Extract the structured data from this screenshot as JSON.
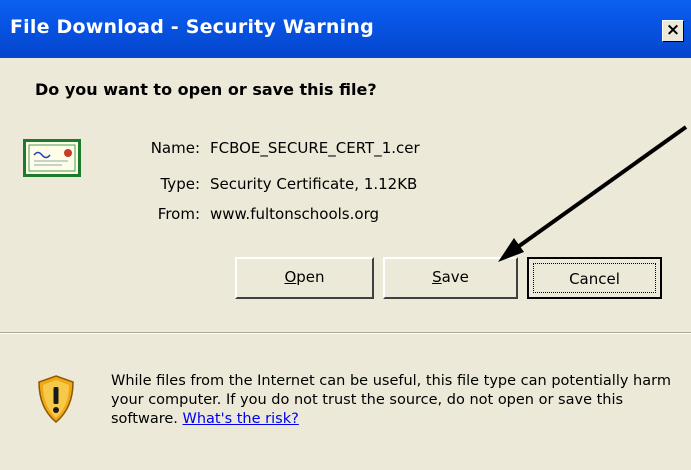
{
  "window": {
    "title": "File Download - Security Warning",
    "close_glyph": "×"
  },
  "prompt": {
    "question": "Do you want to open or save this file?"
  },
  "file": {
    "name_label": "Name:",
    "name_value": "FCBOE_SECURE_CERT_1.cer",
    "type_label": "Type:",
    "type_value": "Security Certificate, 1.12KB",
    "from_label": "From:",
    "from_value": "www.fultonschools.org",
    "icon": "certificate-icon"
  },
  "buttons": {
    "open_mnemonic": "O",
    "open_rest": "pen",
    "save_mnemonic": "S",
    "save_rest": "ave",
    "cancel": "Cancel"
  },
  "warning": {
    "text": "While files from the Internet can be useful, this file type can potentially harm your computer. If you do not trust the source, do not open or save this software. ",
    "link": "What's the risk?",
    "icon": "shield-warning-icon"
  },
  "annotation": {
    "arrow_target": "Save",
    "arrow_color": "#000000"
  },
  "colors": {
    "titlebar": "#0a62ee",
    "dialog_bg": "#ece9d8",
    "link": "#0000ee"
  }
}
